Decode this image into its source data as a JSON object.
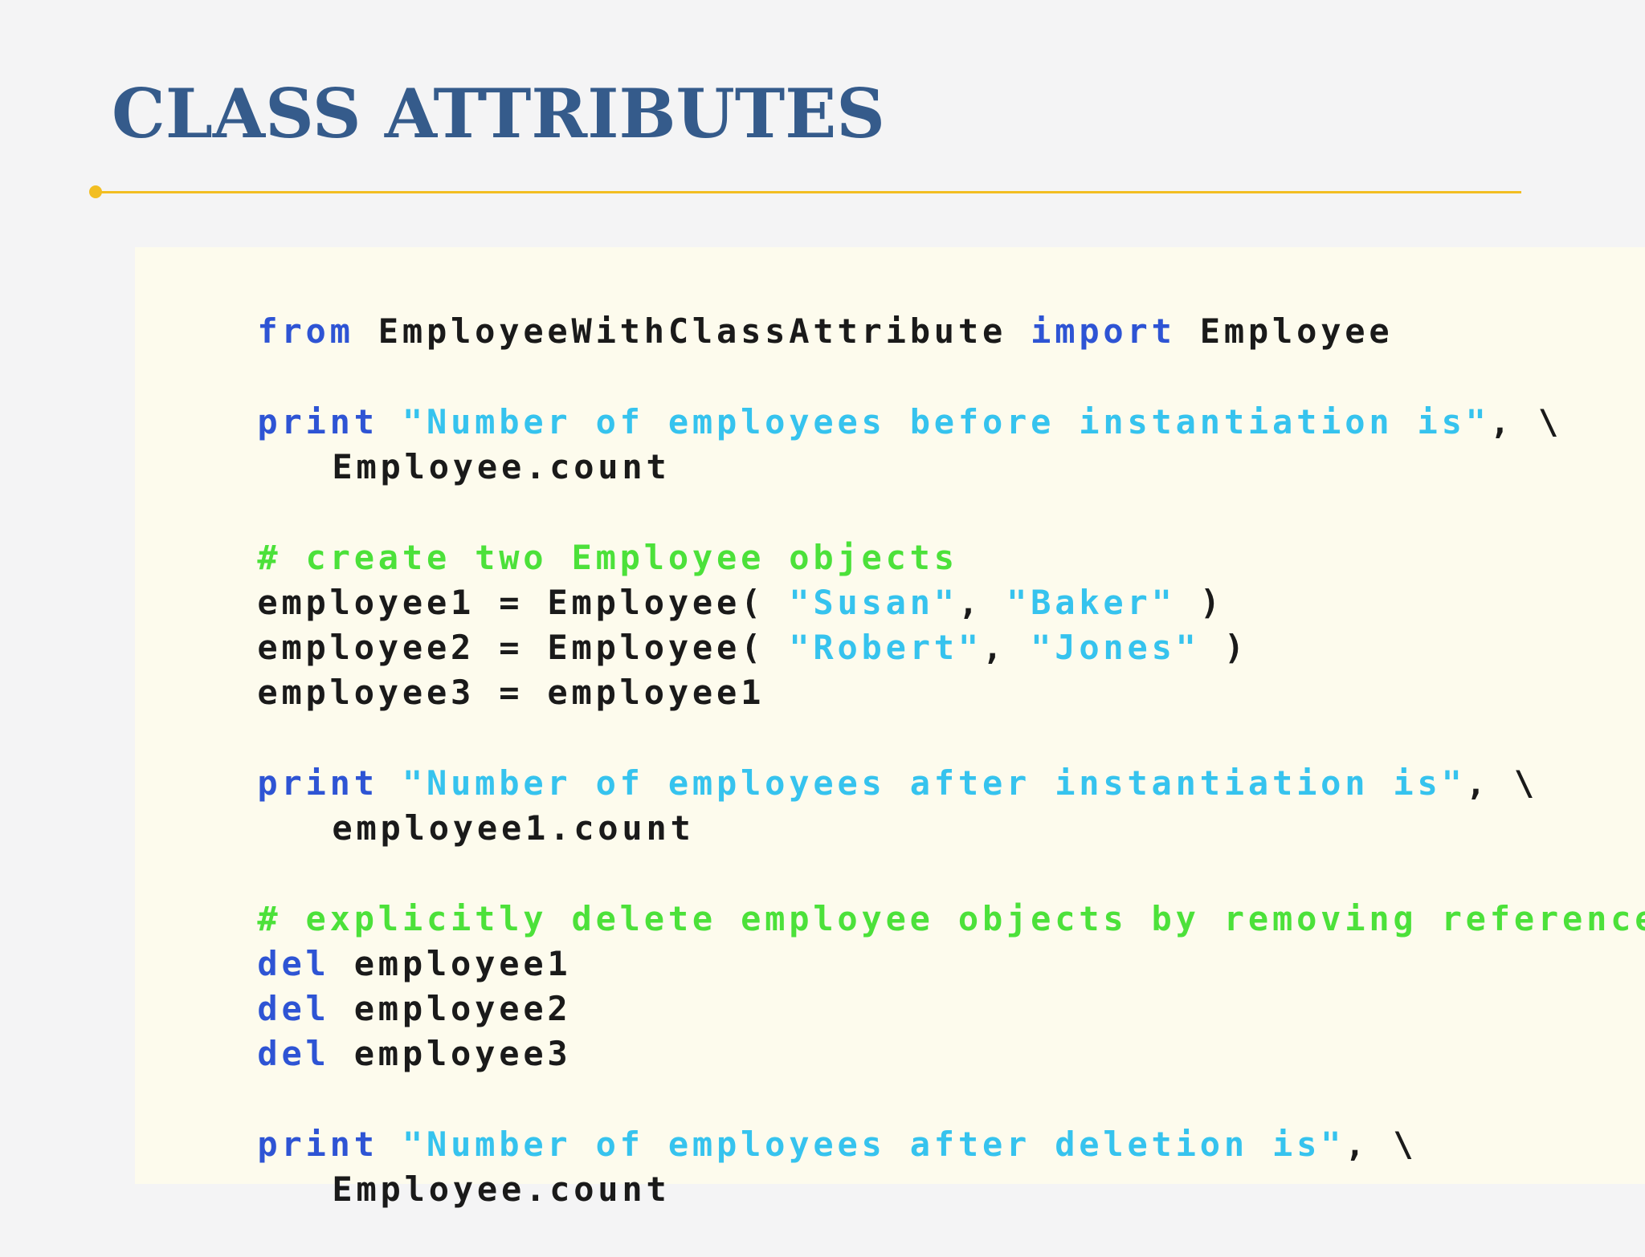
{
  "slide": {
    "title": "CLASS ATTRIBUTES"
  },
  "code": {
    "lines": [
      [
        {
          "t": "kw",
          "v": "from"
        },
        {
          "t": "plain",
          "v": " EmployeeWithClassAttribute "
        },
        {
          "t": "kw",
          "v": "import"
        },
        {
          "t": "plain",
          "v": " Employee"
        }
      ],
      [
        {
          "t": "kw",
          "v": "print"
        },
        {
          "t": "plain",
          "v": " "
        },
        {
          "t": "str",
          "v": "\"Number of employees before instantiation is\""
        },
        {
          "t": "plain",
          "v": ", \\"
        }
      ],
      [
        {
          "t": "plain",
          "v": "Employee.count"
        }
      ],
      [
        {
          "t": "com",
          "v": "# create two Employee objects"
        }
      ],
      [
        {
          "t": "plain",
          "v": "employee1 = Employee( "
        },
        {
          "t": "str",
          "v": "\"Susan\""
        },
        {
          "t": "plain",
          "v": ", "
        },
        {
          "t": "str",
          "v": "\"Baker\""
        },
        {
          "t": "plain",
          "v": " )"
        }
      ],
      [
        {
          "t": "plain",
          "v": "employee2 = Employee( "
        },
        {
          "t": "str",
          "v": "\"Robert\""
        },
        {
          "t": "plain",
          "v": ", "
        },
        {
          "t": "str",
          "v": "\"Jones\""
        },
        {
          "t": "plain",
          "v": " )"
        }
      ],
      [
        {
          "t": "plain",
          "v": "employee3 = employee1"
        }
      ],
      [
        {
          "t": "kw",
          "v": "print"
        },
        {
          "t": "plain",
          "v": " "
        },
        {
          "t": "str",
          "v": "\"Number of employees after instantiation is\""
        },
        {
          "t": "plain",
          "v": ", \\"
        }
      ],
      [
        {
          "t": "plain",
          "v": "employee1.count"
        }
      ],
      [
        {
          "t": "com",
          "v": "# explicitly delete employee objects by removing references"
        }
      ],
      [
        {
          "t": "kw",
          "v": "del"
        },
        {
          "t": "plain",
          "v": " employee1"
        }
      ],
      [
        {
          "t": "kw",
          "v": "del"
        },
        {
          "t": "plain",
          "v": " employee2"
        }
      ],
      [
        {
          "t": "kw",
          "v": "del"
        },
        {
          "t": "plain",
          "v": " employee3"
        }
      ],
      [
        {
          "t": "kw",
          "v": "print"
        },
        {
          "t": "plain",
          "v": " "
        },
        {
          "t": "str",
          "v": "\"Number of employees after deletion is\""
        },
        {
          "t": "plain",
          "v": ", \\"
        }
      ],
      [
        {
          "t": "plain",
          "v": "Employee.count"
        }
      ]
    ]
  },
  "colors": {
    "title": "#355b8b",
    "accent_rule": "#f2be22",
    "code_background": "#fdfbed",
    "keyword": "#2e54d4",
    "string": "#36c3ee",
    "comment": "#4ce13a",
    "plain": "#1a1a1a"
  }
}
